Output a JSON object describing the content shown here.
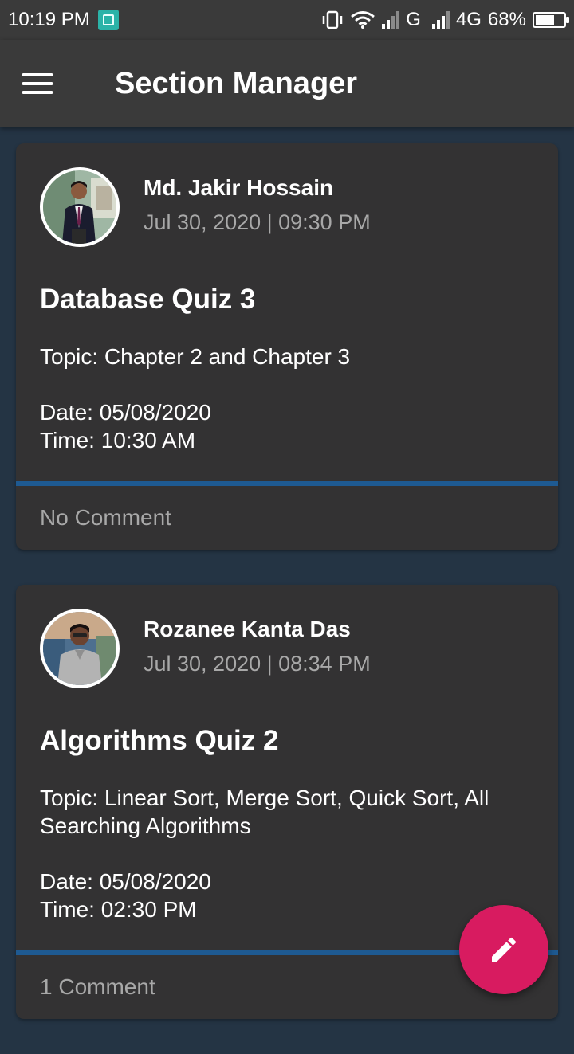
{
  "status_bar": {
    "time": "10:19 PM",
    "network_type": "G",
    "network_type_2": "4G",
    "battery_percent": "68%",
    "battery_level": 0.68
  },
  "app_bar": {
    "title": "Section Manager",
    "menu_icon": "hamburger-menu-icon"
  },
  "posts": [
    {
      "author": "Md. Jakir Hossain",
      "date": "Jul 30, 2020 | 09:30 PM",
      "title": "Database Quiz 3",
      "topic": "Topic: Chapter 2 and Chapter 3",
      "quiz_date": "Date: 05/08/2020",
      "quiz_time": "Time: 10:30 AM",
      "comments": "No Comment"
    },
    {
      "author": "Rozanee Kanta Das",
      "date": "Jul 30, 2020 | 08:34 PM",
      "title": "Algorithms Quiz 2",
      "topic": "Topic: Linear Sort, Merge Sort, Quick Sort, All Searching Algorithms",
      "quiz_date": "Date: 05/08/2020",
      "quiz_time": "Time: 02:30 PM",
      "comments": "1 Comment"
    }
  ],
  "fab": {
    "icon": "pencil-icon",
    "color": "#d81b60"
  },
  "colors": {
    "background": "#243444",
    "card": "#333233",
    "bar": "#3a3a3a",
    "accent_divider": "#1e5a92"
  }
}
